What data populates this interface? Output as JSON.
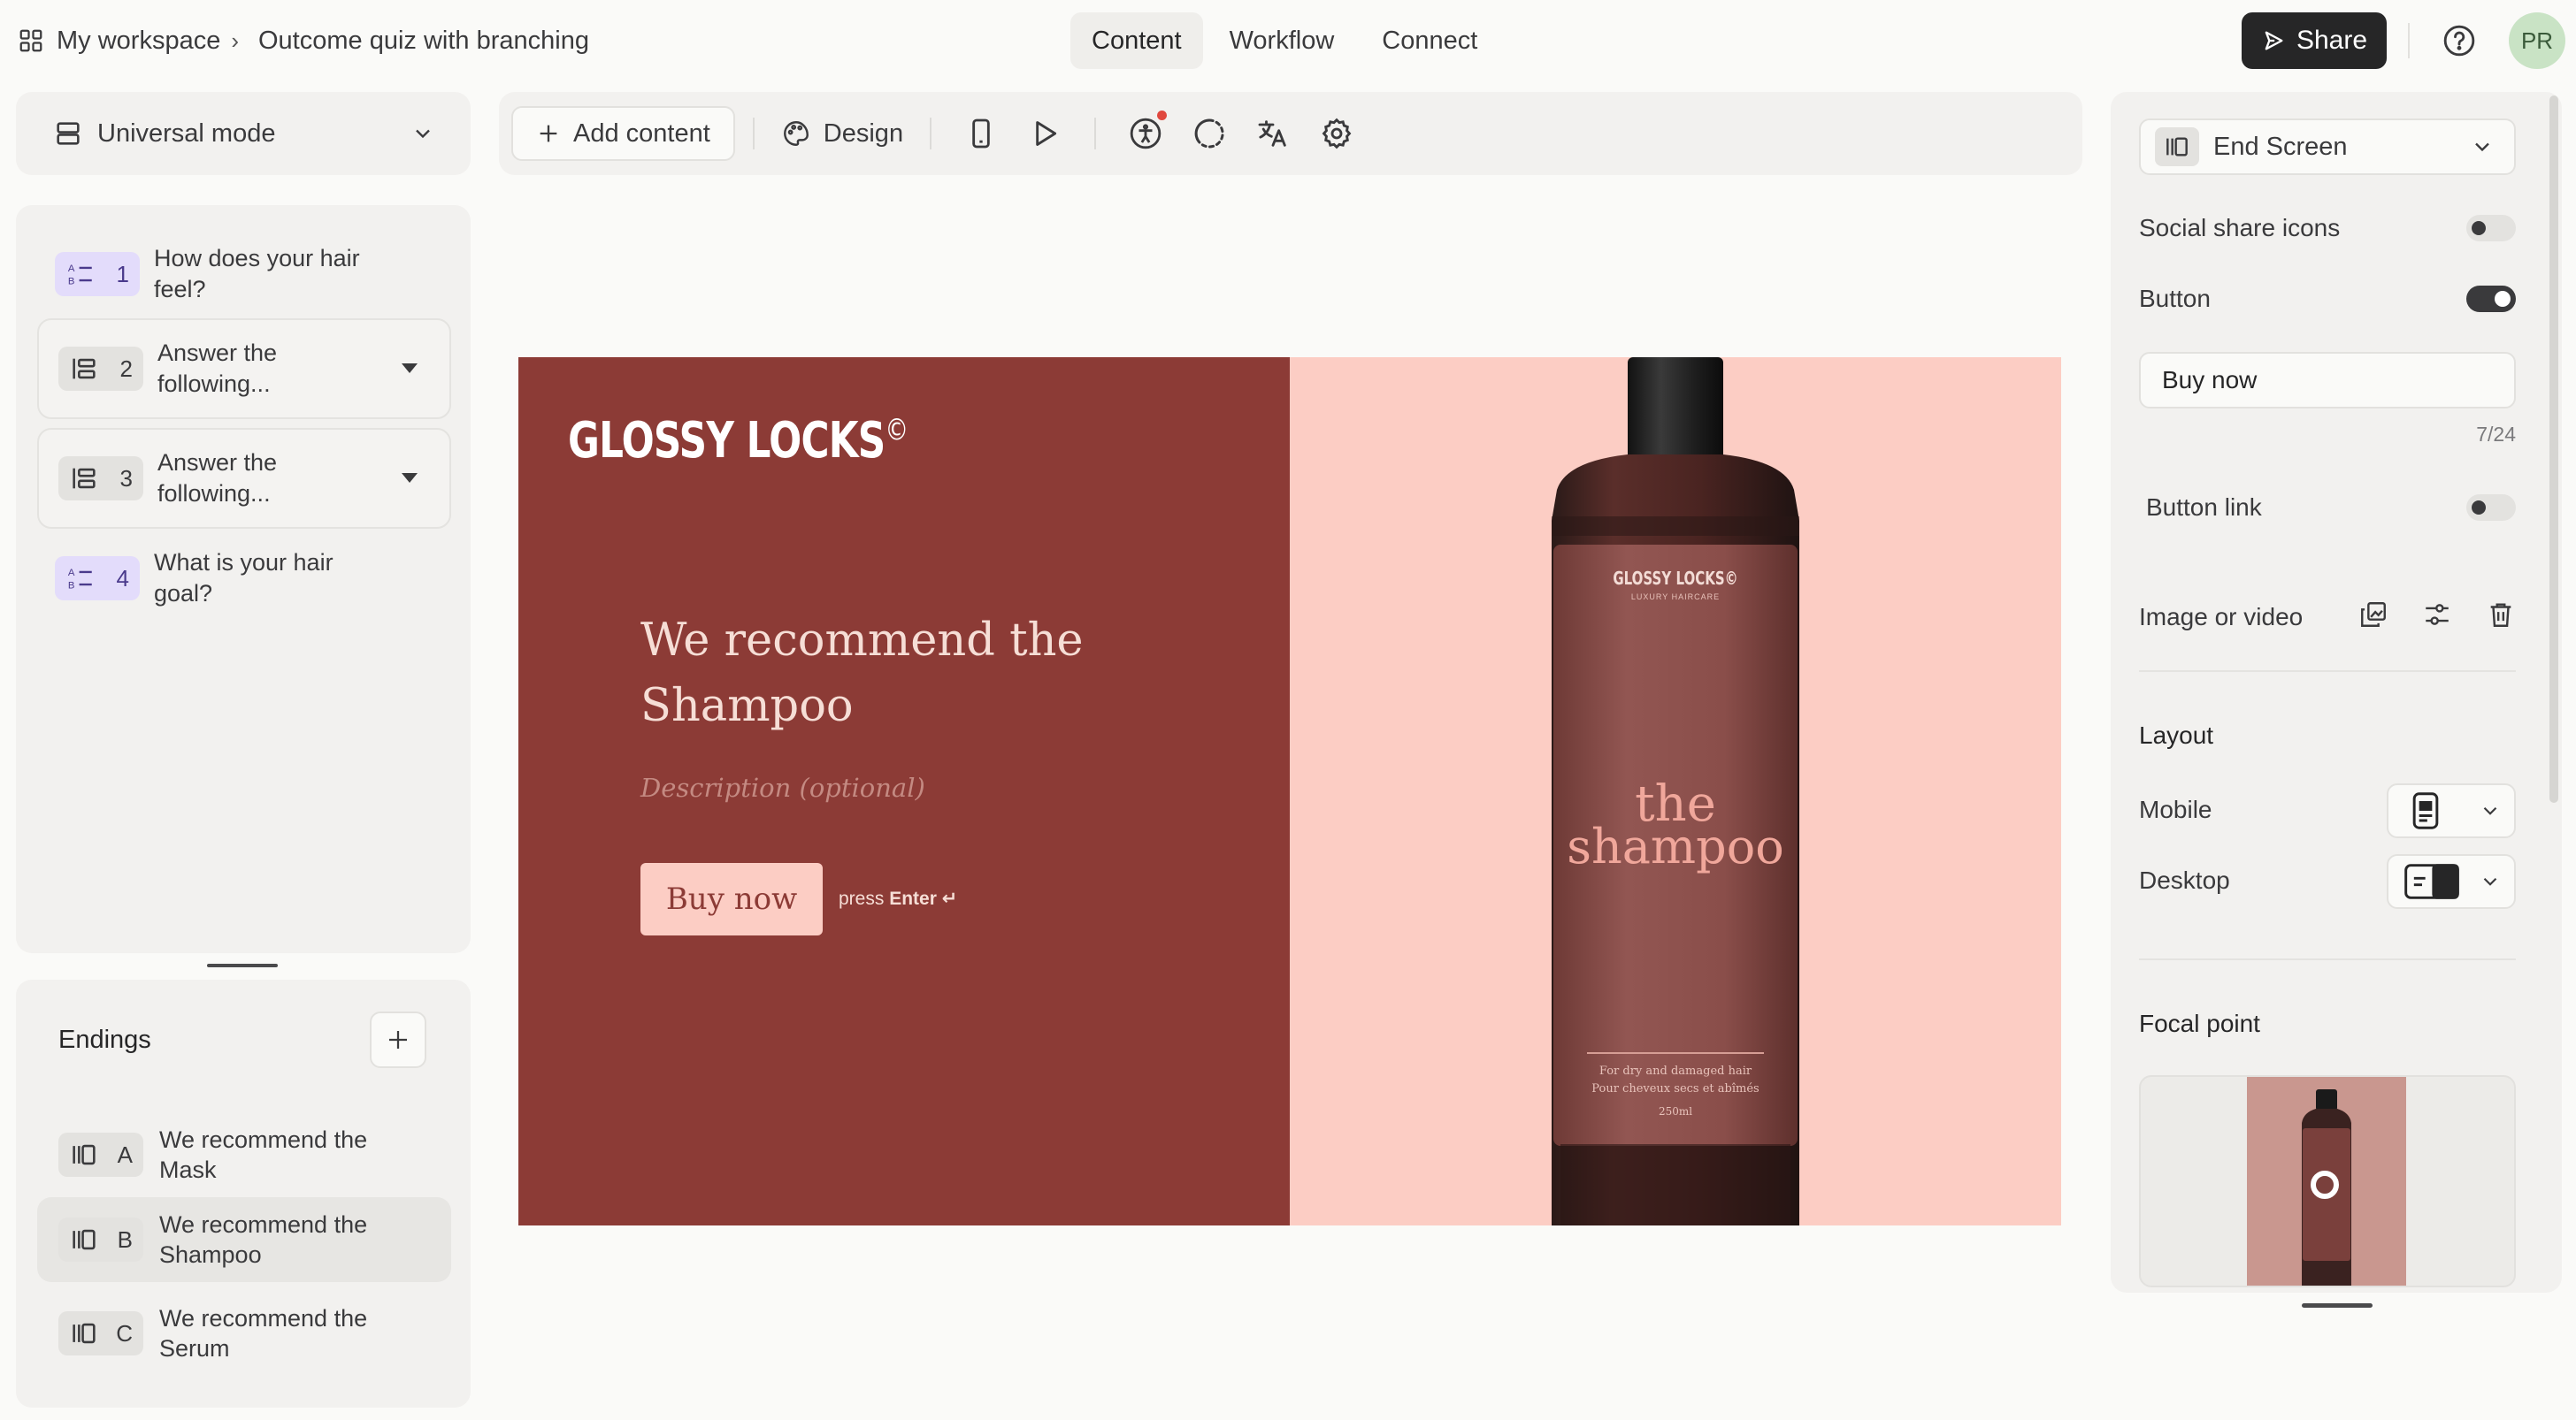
{
  "header": {
    "workspace": "My workspace",
    "form_title": "Outcome quiz with branching",
    "tabs": [
      {
        "label": "Content",
        "active": true
      },
      {
        "label": "Workflow",
        "active": false
      },
      {
        "label": "Connect",
        "active": false
      }
    ],
    "share_label": "Share",
    "avatar_initials": "PR"
  },
  "sidebar": {
    "mode_label": "Universal mode",
    "questions": [
      {
        "number": "1",
        "label": "How does your hair feel?",
        "type_icon": "multiple-choice-icon"
      },
      {
        "number": "2",
        "label": "Answer the following...",
        "type_icon": "group-icon"
      },
      {
        "number": "3",
        "label": "Answer the following...",
        "type_icon": "group-icon"
      },
      {
        "number": "4",
        "label": "What is your hair goal?",
        "type_icon": "multiple-choice-icon"
      }
    ],
    "endings_title": "Endings",
    "endings": [
      {
        "letter": "A",
        "label": "We recommend the Mask",
        "active": false
      },
      {
        "letter": "B",
        "label": "We recommend the Shampoo",
        "active": true
      },
      {
        "letter": "C",
        "label": "We recommend the Serum",
        "active": false
      }
    ]
  },
  "toolbar": {
    "add_content_label": "Add content",
    "design_label": "Design",
    "icons": [
      "mobile-preview-icon",
      "play-icon",
      "accessibility-icon",
      "loading-icon",
      "translate-icon",
      "settings-icon"
    ]
  },
  "canvas": {
    "brand": "GLOSSY LOCKS",
    "brand_mark": "©",
    "headline": "We recommend the Shampoo",
    "description_placeholder": "Description (optional)",
    "button_label": "Buy now",
    "press_hint": "press",
    "press_key": "Enter ↵",
    "bottle": {
      "brand": "GLOSSY LOCKS©",
      "subbrand": "LUXURY HAIRCARE",
      "product_line1": "the",
      "product_line2": "shampoo",
      "small1": "For dry and damaged hair",
      "small2": "Pour cheveux secs et abîmés",
      "volume": "250ml"
    },
    "colors": {
      "left_bg": "#8c3b36",
      "right_bg": "#fccdc4"
    }
  },
  "properties": {
    "screen_type": "End Screen",
    "social_share_label": "Social share icons",
    "social_share_on": false,
    "button_label": "Button",
    "button_on": true,
    "button_text_value": "Buy now",
    "button_text_counter": "7/24",
    "button_link_label": "Button link",
    "button_link_on": false,
    "image_label": "Image or video",
    "layout_title": "Layout",
    "mobile_label": "Mobile",
    "desktop_label": "Desktop",
    "focal_title": "Focal point"
  }
}
